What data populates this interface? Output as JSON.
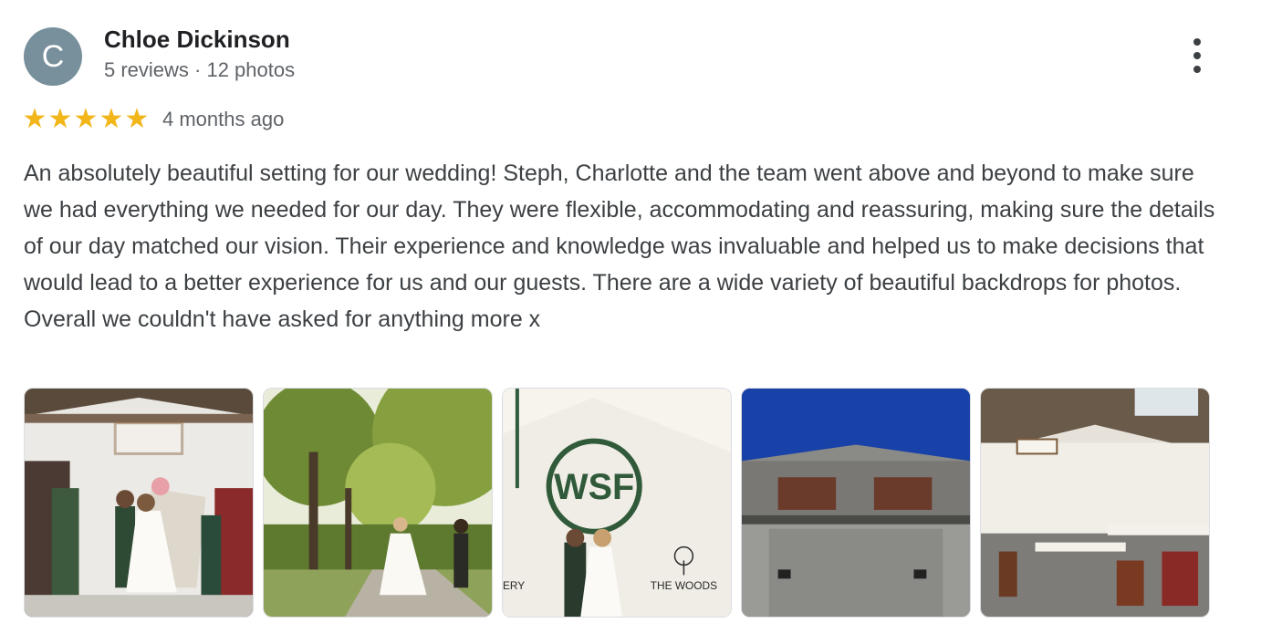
{
  "reviewer": {
    "initial": "C",
    "name": "Chloe Dickinson",
    "meta": "5 reviews · 12 photos",
    "avatar_color": "#78909c"
  },
  "rating": {
    "stars": 5,
    "max": 5,
    "star_glyph": "★",
    "time_ago": "4 months ago",
    "star_color": "#f2b61a"
  },
  "review_text": "An absolutely beautiful setting for our wedding! Steph, Charlotte and the team went above and beyond to make sure we had everything we needed for our day. They were flexible, accommodating and reassuring, making sure the details of our day matched our vision. Their experience and knowledge was invaluable and helped us to make decisions that would lead to a better experience for us and our guests. There are a wide variety of beautiful backdrops for photos. Overall we couldn't have asked for anything more x",
  "photos": [
    {
      "icon": "ceremony-photo"
    },
    {
      "icon": "couple-walking-photo"
    },
    {
      "icon": "barn-sign-photo",
      "sign_text": "WSF",
      "wall_text_left": "ERY",
      "wall_text_right": "THE WOODS"
    },
    {
      "icon": "barn-exterior-photo"
    },
    {
      "icon": "reception-hall-photo"
    }
  ],
  "menu_icon": "more-vert-icon"
}
